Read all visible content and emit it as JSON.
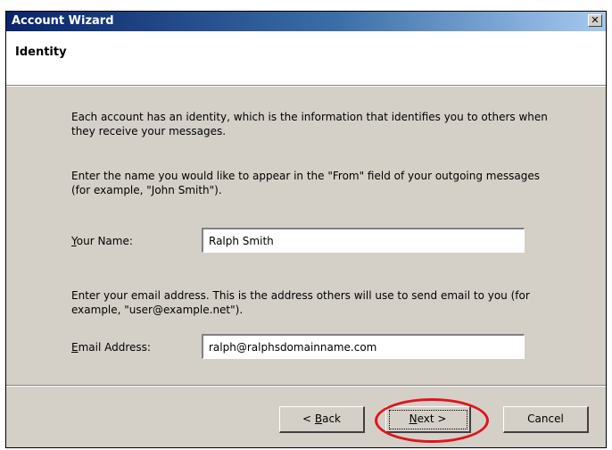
{
  "window": {
    "title": "Account Wizard",
    "close_glyph": "✕"
  },
  "header": {
    "title": "Identity"
  },
  "body": {
    "intro_text": "Each account has an identity, which is the information that identifies you to others when they receive your messages.",
    "name_instruction": "Enter the name you would like to appear in the \"From\" field of your outgoing messages (for example, \"John Smith\").",
    "name_label_accel": "Y",
    "name_label_rest": "our Name:",
    "name_value": "Ralph Smith",
    "email_instruction": "Enter your email address. This is the address others will use to send email to you (for example, \"user@example.net\").",
    "email_label_accel": "E",
    "email_label_rest": "mail Address:",
    "email_value": "ralph@ralphsdomainname.com"
  },
  "footer": {
    "back_prefix": "< ",
    "back_accel": "B",
    "back_rest": "ack",
    "next_accel": "N",
    "next_rest": "ext >",
    "cancel_label": "Cancel"
  },
  "colors": {
    "title_bar_start": "#0a246a",
    "title_bar_end": "#a6caf0",
    "dialog_face": "#d4d0c8",
    "highlight_annotation": "#e0141e"
  }
}
